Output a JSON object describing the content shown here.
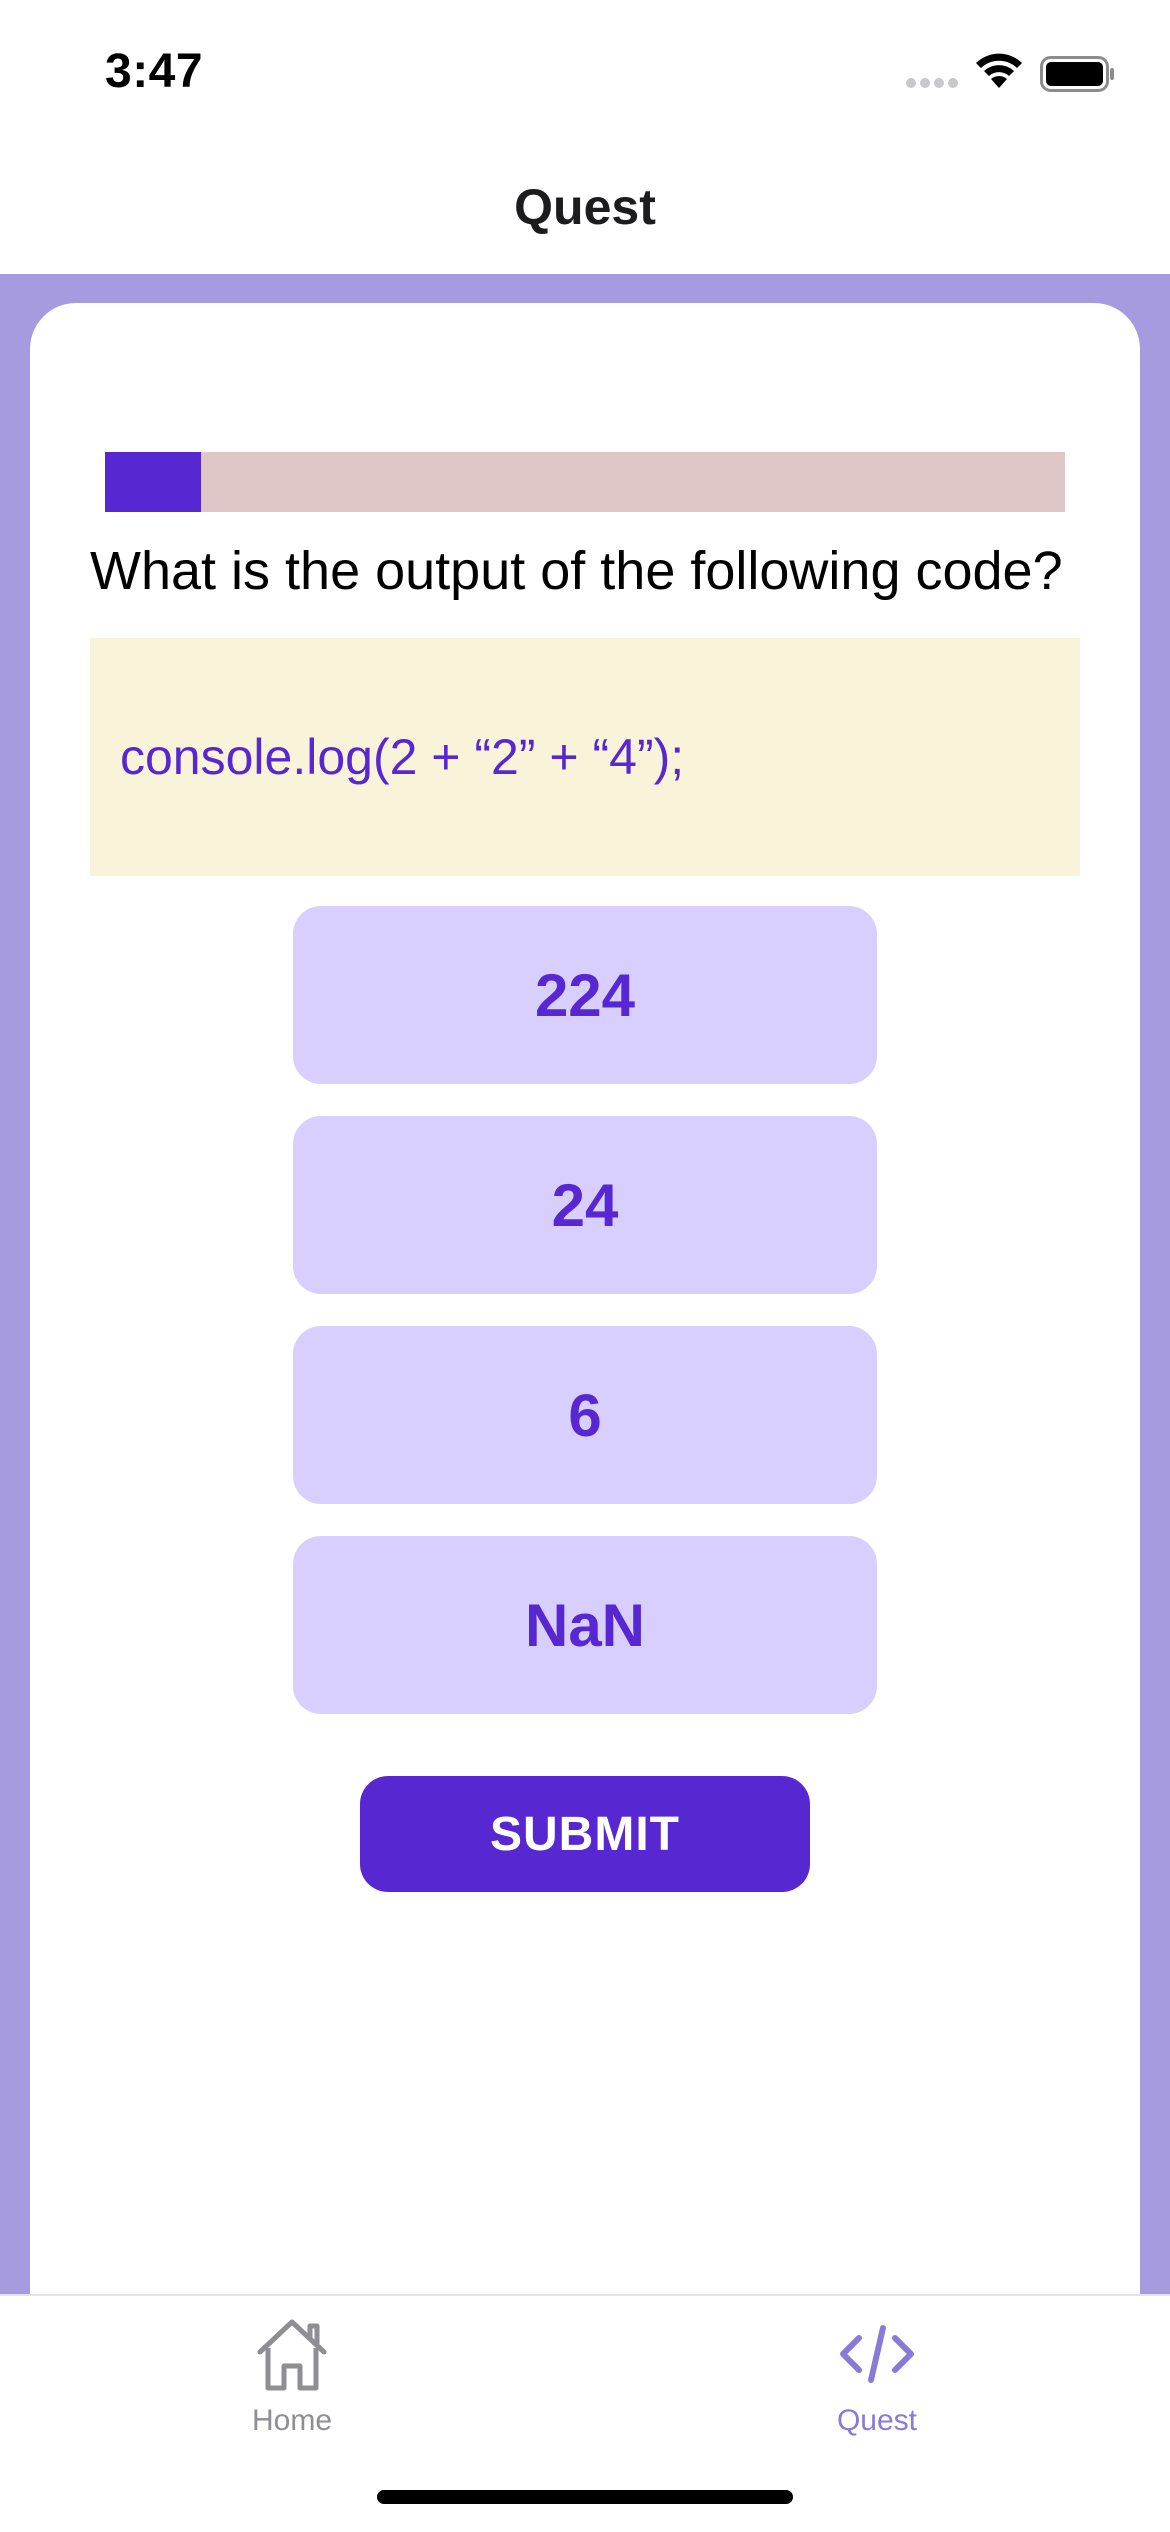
{
  "status_bar": {
    "time": "3:47"
  },
  "header": {
    "title": "Quest"
  },
  "quiz": {
    "progress": 0.1,
    "question": "What is the output of the following code?",
    "code": "console.log(2 + “2” + “4”);",
    "options": [
      {
        "label": "224"
      },
      {
        "label": "24"
      },
      {
        "label": "6"
      },
      {
        "label": "NaN"
      }
    ],
    "submit_label": "SUBMIT"
  },
  "tabs": [
    {
      "label": "Home",
      "icon": "house-icon",
      "active": false
    },
    {
      "label": "Quest",
      "icon": "code-icon",
      "active": true
    }
  ],
  "colors": {
    "accent": "#5728d1",
    "backdrop": "#a79be0",
    "option_bg": "#d8cffe",
    "code_bg": "#f8f3d9",
    "progress_track": "#dfc7c7",
    "tab_active": "#8a7ad8",
    "tab_inactive": "#8e8e93"
  }
}
